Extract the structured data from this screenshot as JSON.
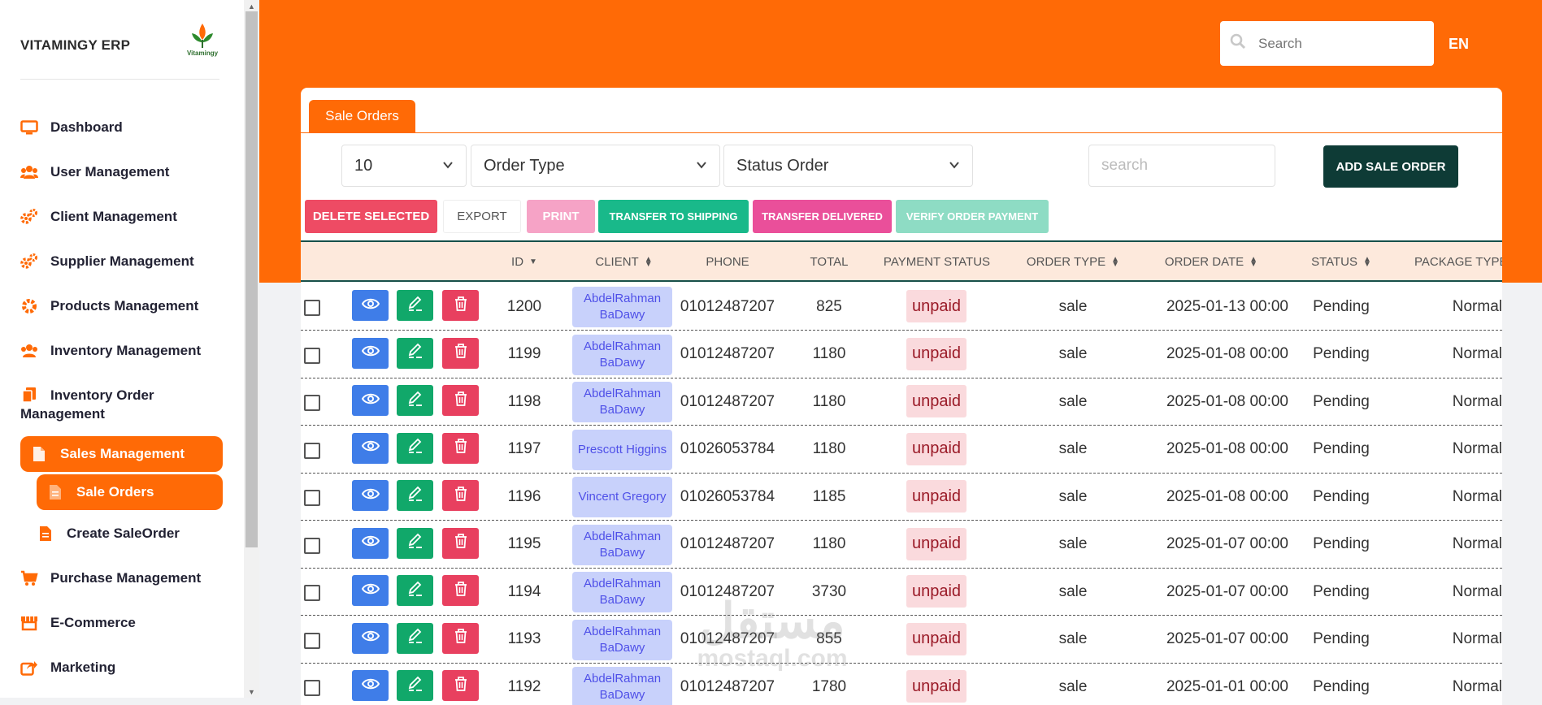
{
  "app": {
    "brand": "VITAMINGY ERP",
    "logo_text": "Vitamingy",
    "language": "EN"
  },
  "header": {
    "search_placeholder": "Search"
  },
  "sidebar": {
    "items": [
      {
        "label": "Dashboard",
        "icon": "monitor-icon"
      },
      {
        "label": "User Management",
        "icon": "users-icon"
      },
      {
        "label": "Client Management",
        "icon": "gears-icon"
      },
      {
        "label": "Supplier Management",
        "icon": "gears-icon"
      },
      {
        "label": "Products Management",
        "icon": "gear-icon"
      },
      {
        "label": "Inventory Management",
        "icon": "users-gear-icon"
      },
      {
        "label": "Inventory Order Management",
        "icon": "copy-icon"
      },
      {
        "label": "Sales Management",
        "icon": "file-icon"
      },
      {
        "label": "Sale Orders",
        "icon": "file-invoice-icon"
      },
      {
        "label": "Create SaleOrder",
        "icon": "file-invoice-icon"
      },
      {
        "label": "Purchase Management",
        "icon": "cart-icon"
      },
      {
        "label": "E-Commerce",
        "icon": "storefront-icon"
      },
      {
        "label": "Marketing",
        "icon": "share-icon"
      }
    ]
  },
  "tab": {
    "label": "Sale Orders"
  },
  "filters": {
    "page_size": "10",
    "order_type": "Order Type",
    "status_order": "Status Order",
    "search_placeholder": "search",
    "add_label": "ADD SALE ORDER"
  },
  "actions": {
    "delete_selected": "DELETE SELECTED",
    "export": "EXPORT",
    "print": "PRINT",
    "transfer_shipping": "TRANSFER TO SHIPPING",
    "transfer_delivered": "TRANSFER DELIVERED",
    "verify_payment": "VERIFY ORDER PAYMENT"
  },
  "table": {
    "headers": {
      "id": "ID",
      "client": "CLIENT",
      "phone": "PHONE",
      "total": "TOTAL",
      "payment_status": "PAYMENT STATUS",
      "order_type": "ORDER TYPE",
      "order_date": "ORDER DATE",
      "status": "STATUS",
      "package_type": "PACKAGE TYPE"
    },
    "rows": [
      {
        "id": "1200",
        "client": "AbdelRahman BaDawy",
        "phone": "01012487207",
        "total": "825",
        "payment": "unpaid",
        "type": "sale",
        "date": "2025-01-13 00:00",
        "status": "Pending",
        "package": "Normal"
      },
      {
        "id": "1199",
        "client": "AbdelRahman BaDawy",
        "phone": "01012487207",
        "total": "1180",
        "payment": "unpaid",
        "type": "sale",
        "date": "2025-01-08 00:00",
        "status": "Pending",
        "package": "Normal"
      },
      {
        "id": "1198",
        "client": "AbdelRahman BaDawy",
        "phone": "01012487207",
        "total": "1180",
        "payment": "unpaid",
        "type": "sale",
        "date": "2025-01-08 00:00",
        "status": "Pending",
        "package": "Normal"
      },
      {
        "id": "1197",
        "client": "Prescott Higgins",
        "phone": "01026053784",
        "total": "1180",
        "payment": "unpaid",
        "type": "sale",
        "date": "2025-01-08 00:00",
        "status": "Pending",
        "package": "Normal"
      },
      {
        "id": "1196",
        "client": "Vincent Gregory",
        "phone": "01026053784",
        "total": "1185",
        "payment": "unpaid",
        "type": "sale",
        "date": "2025-01-08 00:00",
        "status": "Pending",
        "package": "Normal"
      },
      {
        "id": "1195",
        "client": "AbdelRahman BaDawy",
        "phone": "01012487207",
        "total": "1180",
        "payment": "unpaid",
        "type": "sale",
        "date": "2025-01-07 00:00",
        "status": "Pending",
        "package": "Normal"
      },
      {
        "id": "1194",
        "client": "AbdelRahman BaDawy",
        "phone": "01012487207",
        "total": "3730",
        "payment": "unpaid",
        "type": "sale",
        "date": "2025-01-07 00:00",
        "status": "Pending",
        "package": "Normal"
      },
      {
        "id": "1193",
        "client": "AbdelRahman BaDawy",
        "phone": "01012487207",
        "total": "855",
        "payment": "unpaid",
        "type": "sale",
        "date": "2025-01-07 00:00",
        "status": "Pending",
        "package": "Normal"
      },
      {
        "id": "1192",
        "client": "AbdelRahman BaDawy",
        "phone": "01012487207",
        "total": "1780",
        "payment": "unpaid",
        "type": "sale",
        "date": "2025-01-01 00:00",
        "status": "Pending",
        "package": "Normal"
      }
    ]
  },
  "watermark": {
    "line1": "مستقل",
    "line2": "mostaql.com"
  },
  "colors": {
    "accent": "#ff6a06",
    "dark_green": "#0e3b36",
    "view": "#3f7de8",
    "edit": "#11a86a",
    "delete": "#e8405f"
  }
}
